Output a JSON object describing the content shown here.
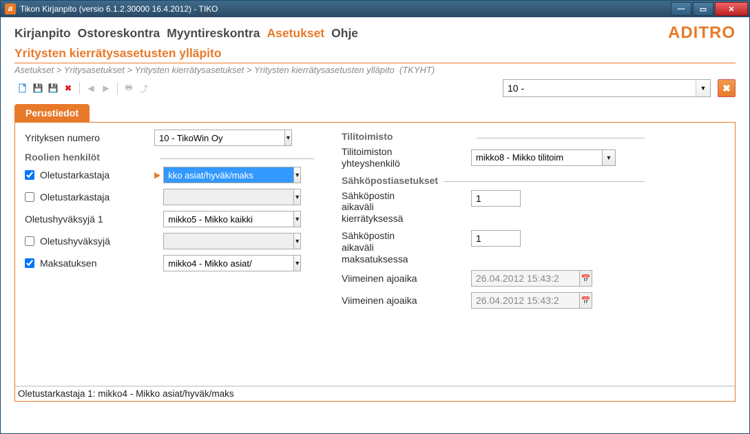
{
  "window_title": "Tikon Kirjanpito (versio 6.1.2.30000 16.4.2012) - TIKO",
  "logo": "ADITRO",
  "menu": [
    "Kirjanpito",
    "Ostoreskontra",
    "Myyntireskontra",
    "Asetukset",
    "Ohje"
  ],
  "active_menu_index": 3,
  "page_title": "Yritysten kierrätysasetusten ylläpito",
  "breadcrumb": {
    "items": [
      "Asetukset",
      "Yritysasetukset",
      "Yritysten kierrätysasetukset",
      "Yritysten kierrätysasetusten ylläpito"
    ],
    "code": "(TKYHT)"
  },
  "top_select_value": "10 -",
  "tab_label": "Perustiedot",
  "left": {
    "company_label": "Yrityksen numero",
    "company_value": "10 - TikoWin Oy",
    "roles_section": "Roolien henkilöt",
    "rows": [
      {
        "checkbox": true,
        "checked": true,
        "label": "Oletustarkastaja",
        "value": "kko asiat/hyväk/maks",
        "highlighted": true,
        "current": true
      },
      {
        "checkbox": true,
        "checked": false,
        "label": "Oletustarkastaja",
        "value": "",
        "disabled": true
      },
      {
        "checkbox": false,
        "label": "Oletushyväksyjä 1",
        "value": "mikko5 - Mikko kaikki"
      },
      {
        "checkbox": true,
        "checked": false,
        "label": "Oletushyväksyjä",
        "value": "",
        "disabled": true
      },
      {
        "checkbox": true,
        "checked": true,
        "label": "Maksatuksen",
        "value": "mikko4 - Mikko asiat/"
      }
    ]
  },
  "right": {
    "office_section": "Tilitoimisto",
    "office_contact_label_1": "Tilitoimiston",
    "office_contact_label_2": "yhteyshenkilö",
    "office_contact_value": "mikko8 - Mikko tilitoim",
    "email_section": "Sähköpostiasetukset",
    "interval1_l1": "Sähköpostin",
    "interval1_l2": "aikaväli",
    "interval1_l3": "kierrätyksessä",
    "interval1_value": "1",
    "interval2_l1": "Sähköpostin",
    "interval2_l2": "aikaväli",
    "interval2_l3": "maksatuksessa",
    "interval2_value": "1",
    "lastrun_label": "Viimeinen ajoaika",
    "lastrun1": "26.04.2012 15:43:2",
    "lastrun2": "26.04.2012 15:43:2"
  },
  "statusbar": "Oletustarkastaja 1: mikko4 - Mikko asiat/hyväk/maks"
}
